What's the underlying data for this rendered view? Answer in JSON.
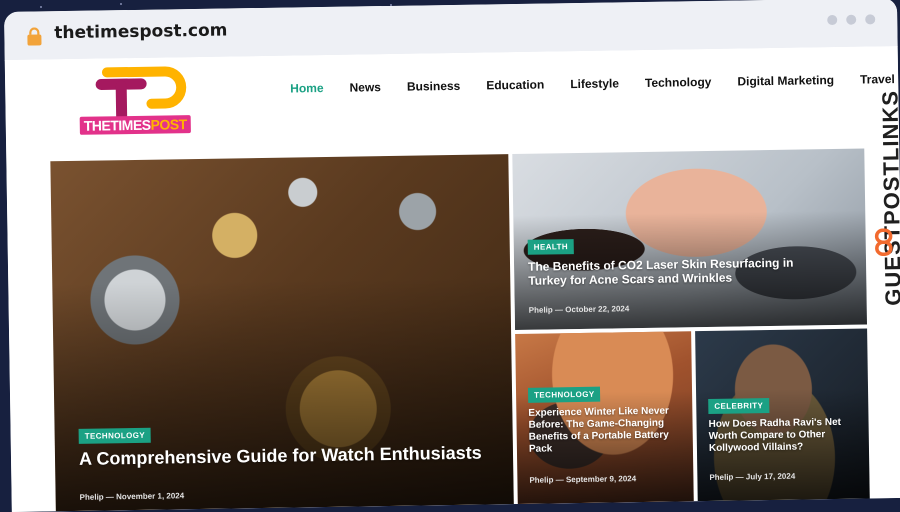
{
  "browser": {
    "url": "thetimespost.com"
  },
  "site": {
    "logo_text_part1": "THETIMES",
    "logo_text_part2": "POST",
    "nav": [
      {
        "label": "Home",
        "active": true
      },
      {
        "label": "News",
        "active": false
      },
      {
        "label": "Business",
        "active": false
      },
      {
        "label": "Education",
        "active": false
      },
      {
        "label": "Lifestyle",
        "active": false
      },
      {
        "label": "Technology",
        "active": false
      },
      {
        "label": "Digital Marketing",
        "active": false
      },
      {
        "label": "Travel",
        "active": false
      }
    ]
  },
  "side_brand": {
    "text": "GUESTPOSTLINKS"
  },
  "articles": [
    {
      "tag": "TECHNOLOGY",
      "title": "A Comprehensive Guide for Watch Enthusiasts",
      "author": "Phelip",
      "date": "November 1, 2024"
    },
    {
      "tag": "HEALTH",
      "title": "The Benefits of CO2 Laser Skin Resurfacing in Turkey for Acne Scars and Wrinkles",
      "author": "Phelip",
      "date": "October 22, 2024"
    },
    {
      "tag": "TECHNOLOGY",
      "title": "Experience Winter Like Never Before: The Game-Changing Benefits of a Portable Battery Pack",
      "author": "Phelip",
      "date": "September 9, 2024"
    },
    {
      "tag": "CELEBRITY",
      "title": "How Does Radha Ravi's Net Worth Compare to Other Kollywood Villains?",
      "author": "Phelip",
      "date": "July 17, 2024"
    }
  ],
  "meta_separator": "—",
  "colors": {
    "accent": "#1ba184",
    "logo_pink": "#e2328a",
    "logo_orange": "#ffb300",
    "side_icon": "#f26a2e"
  }
}
